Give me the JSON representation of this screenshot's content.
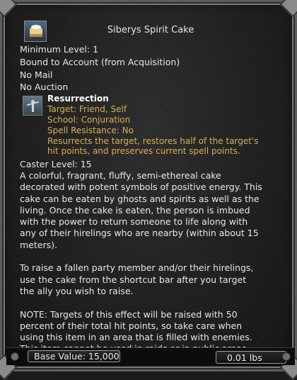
{
  "item": {
    "name": "Siberys Spirit Cake",
    "icon": "spirit-cake-icon",
    "properties": [
      "Minimum Level: 1",
      "Bound to Account (from Acquisition)",
      "No Mail",
      "No Auction"
    ]
  },
  "spell": {
    "icon": "resurrection-icon",
    "name": "Resurrection",
    "lines": [
      "Target: Friend, Self",
      "School: Conjuration",
      "Spell Resistance: No",
      "Resurrects the target, restores half of the target's",
      "hit points, and preserves current spell points."
    ],
    "text_color": "#d9b045"
  },
  "caster_level": "Caster Level: 15",
  "description": [
    "A colorful, fragrant, fluffy, semi-ethereal cake",
    "decorated with potent symbols of positive energy. This",
    "cake can be eaten by ghosts and spirits as well as the",
    "living. Once the cake is eaten, the person is imbued",
    "with the power to return someone to life along with",
    "any of their hirelings who are nearby (within about 15",
    "meters).",
    "",
    "To raise a fallen party member and/or their hirelings,",
    "use the cake from the shortcut bar after you target",
    "the ally you wish to raise.",
    "",
    "NOTE: Targets of this effect will be raised with 50",
    "percent of their total hit points, so take care when",
    "using this item in an area that is filled with enemies.",
    "This item cannot be used in raids or in public areas."
  ],
  "footer": {
    "base_value": "Base Value: 15,000",
    "weight": "0.01 lbs"
  }
}
